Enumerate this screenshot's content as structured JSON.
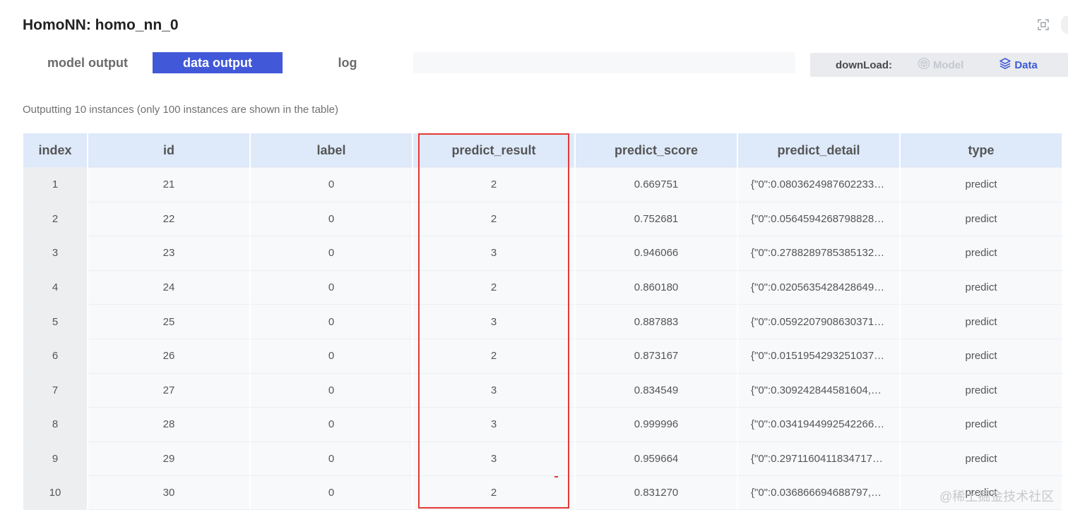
{
  "header": {
    "title": "HomoNN: homo_nn_0"
  },
  "tabs": [
    {
      "label": "model output",
      "active": false
    },
    {
      "label": "data output",
      "active": true
    },
    {
      "label": "log",
      "active": false
    }
  ],
  "download": {
    "label": "downLoad:",
    "model_label": "Model",
    "data_label": "Data"
  },
  "summary": "Outputting 10 instances (only 100 instances are shown in the table)",
  "table": {
    "columns": [
      "index",
      "id",
      "label",
      "predict_result",
      "predict_score",
      "predict_detail",
      "type"
    ],
    "rows": [
      [
        "1",
        "21",
        "0",
        "2",
        "0.669751",
        "{\"0\":0.0803624987602233…",
        "predict"
      ],
      [
        "2",
        "22",
        "0",
        "2",
        "0.752681",
        "{\"0\":0.0564594268798828…",
        "predict"
      ],
      [
        "3",
        "23",
        "0",
        "3",
        "0.946066",
        "{\"0\":0.2788289785385132…",
        "predict"
      ],
      [
        "4",
        "24",
        "0",
        "2",
        "0.860180",
        "{\"0\":0.0205635428428649…",
        "predict"
      ],
      [
        "5",
        "25",
        "0",
        "3",
        "0.887883",
        "{\"0\":0.0592207908630371…",
        "predict"
      ],
      [
        "6",
        "26",
        "0",
        "2",
        "0.873167",
        "{\"0\":0.0151954293251037…",
        "predict"
      ],
      [
        "7",
        "27",
        "0",
        "3",
        "0.834549",
        "{\"0\":0.309242844581604,…",
        "predict"
      ],
      [
        "8",
        "28",
        "0",
        "3",
        "0.999996",
        "{\"0\":0.0341944992542266…",
        "predict"
      ],
      [
        "9",
        "29",
        "0",
        "3",
        "0.959664",
        "{\"0\":0.2971160411834717…",
        "predict"
      ],
      [
        "10",
        "30",
        "0",
        "2",
        "0.831270",
        "{\"0\":0.036866694688797,…",
        "predict"
      ]
    ]
  },
  "watermark": "@稀土掘金技术社区",
  "icons": {
    "fullscreen": "fullscreen-icon",
    "model": "cube-icon",
    "data": "layers-icon"
  },
  "colors": {
    "accent": "#4159d8",
    "header_bg": "#dee9fa",
    "highlight": "#e53935"
  }
}
